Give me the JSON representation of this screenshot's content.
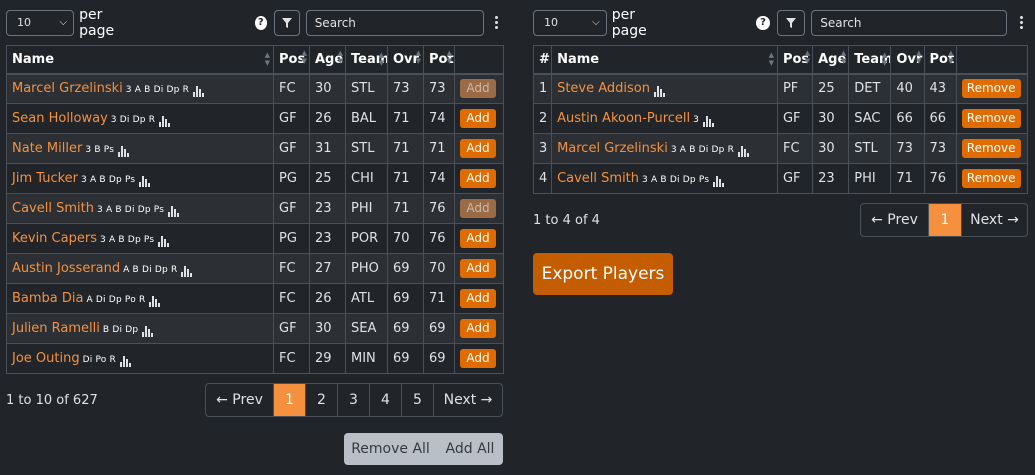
{
  "per_page": {
    "value": "10",
    "label": "per page"
  },
  "search": {
    "placeholder": "Search"
  },
  "left": {
    "columns": [
      "Name",
      "Pos",
      "Age",
      "Team",
      "Ovr",
      "Pot",
      ""
    ],
    "rows": [
      {
        "name": "Marcel Grzelinski",
        "skills": "3 A B Di Dp R",
        "pos": "FC",
        "age": "30",
        "team": "STL",
        "ovr": "73",
        "pot": "73",
        "action": "Add",
        "disabled": true
      },
      {
        "name": "Sean Holloway",
        "skills": "3 Di Dp R",
        "pos": "GF",
        "age": "26",
        "team": "BAL",
        "ovr": "71",
        "pot": "74",
        "action": "Add",
        "disabled": false
      },
      {
        "name": "Nate Miller",
        "skills": "3 B Ps",
        "pos": "GF",
        "age": "31",
        "team": "STL",
        "ovr": "71",
        "pot": "71",
        "action": "Add",
        "disabled": false
      },
      {
        "name": "Jim Tucker",
        "skills": "3 A B Dp Ps",
        "pos": "PG",
        "age": "25",
        "team": "CHI",
        "ovr": "71",
        "pot": "74",
        "action": "Add",
        "disabled": false
      },
      {
        "name": "Cavell Smith",
        "skills": "3 A B Di Dp Ps",
        "pos": "GF",
        "age": "23",
        "team": "PHI",
        "ovr": "71",
        "pot": "76",
        "action": "Add",
        "disabled": true
      },
      {
        "name": "Kevin Capers",
        "skills": "3 A B Dp Ps",
        "pos": "PG",
        "age": "23",
        "team": "POR",
        "ovr": "70",
        "pot": "76",
        "action": "Add",
        "disabled": false
      },
      {
        "name": "Austin Josserand",
        "skills": "A B Di Dp R",
        "pos": "FC",
        "age": "27",
        "team": "PHO",
        "ovr": "69",
        "pot": "70",
        "action": "Add",
        "disabled": false
      },
      {
        "name": "Bamba Dia",
        "skills": "A Di Dp Po R",
        "pos": "FC",
        "age": "26",
        "team": "ATL",
        "ovr": "69",
        "pot": "71",
        "action": "Add",
        "disabled": false
      },
      {
        "name": "Julien Ramelli",
        "skills": "B Di Dp",
        "pos": "GF",
        "age": "30",
        "team": "SEA",
        "ovr": "69",
        "pot": "69",
        "action": "Add",
        "disabled": false
      },
      {
        "name": "Joe Outing",
        "skills": "Di Po R",
        "pos": "FC",
        "age": "29",
        "team": "MIN",
        "ovr": "69",
        "pot": "69",
        "action": "Add",
        "disabled": false
      }
    ],
    "summary": "1 to 10 of 627",
    "pager": [
      "← Prev",
      "1",
      "2",
      "3",
      "4",
      "5",
      "Next →"
    ],
    "active_page": "1",
    "remove_all": "Remove All",
    "add_all": "Add All"
  },
  "right": {
    "columns": [
      "#",
      "Name",
      "Pos",
      "Age",
      "Team",
      "Ovr",
      "Pot",
      ""
    ],
    "rows": [
      {
        "num": "1",
        "name": "Steve Addison",
        "skills": "",
        "pos": "PF",
        "age": "25",
        "team": "DET",
        "ovr": "40",
        "pot": "43",
        "action": "Remove"
      },
      {
        "num": "2",
        "name": "Austin Akoon-Purcell",
        "skills": "3",
        "pos": "GF",
        "age": "30",
        "team": "SAC",
        "ovr": "66",
        "pot": "66",
        "action": "Remove"
      },
      {
        "num": "3",
        "name": "Marcel Grzelinski",
        "skills": "3 A B Di Dp R",
        "pos": "FC",
        "age": "30",
        "team": "STL",
        "ovr": "73",
        "pot": "73",
        "action": "Remove"
      },
      {
        "num": "4",
        "name": "Cavell Smith",
        "skills": "3 A B Di Dp Ps",
        "pos": "GF",
        "age": "23",
        "team": "PHI",
        "ovr": "71",
        "pot": "76",
        "action": "Remove"
      }
    ],
    "summary": "1 to 4 of 4",
    "pager": [
      "← Prev",
      "1",
      "Next →"
    ],
    "active_page": "1",
    "export_label": "Export Players"
  },
  "colors": {
    "accent": "#f5913e",
    "button": "#e06b00",
    "background": "#212529"
  }
}
